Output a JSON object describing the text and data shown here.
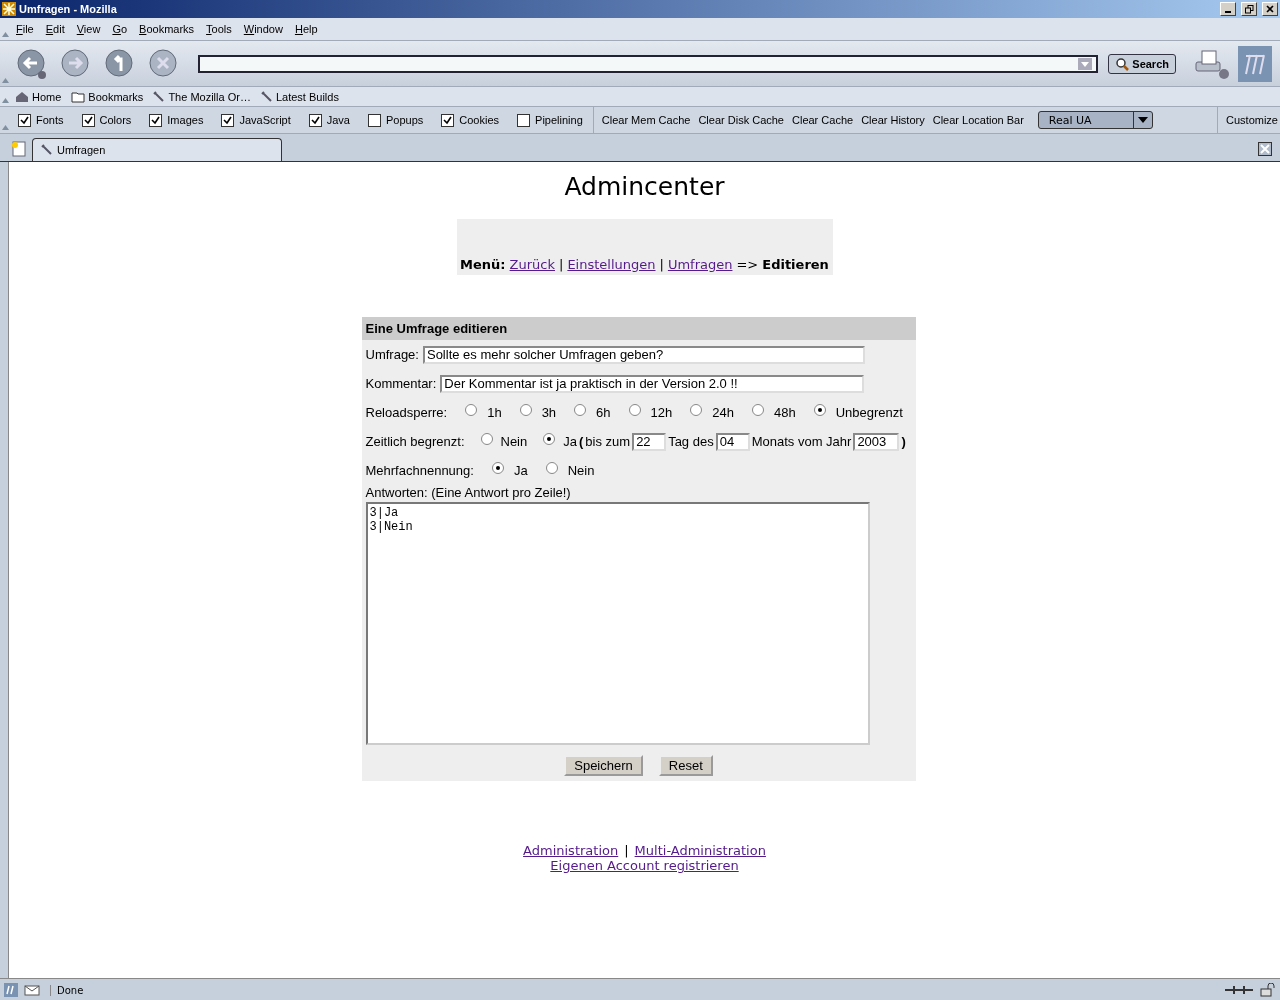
{
  "window": {
    "title": "Umfragen - Mozilla"
  },
  "menu": [
    "File",
    "Edit",
    "View",
    "Go",
    "Bookmarks",
    "Tools",
    "Window",
    "Help"
  ],
  "nav": {
    "search_button": "Search"
  },
  "personal_toolbar": [
    "Home",
    "Bookmarks",
    "The Mozilla Or…",
    "Latest Builds"
  ],
  "prefbar": {
    "checkboxes": [
      {
        "label": "Fonts",
        "checked": true
      },
      {
        "label": "Colors",
        "checked": true
      },
      {
        "label": "Images",
        "checked": true
      },
      {
        "label": "JavaScript",
        "checked": true
      },
      {
        "label": "Java",
        "checked": true
      },
      {
        "label": "Popups",
        "checked": false
      },
      {
        "label": "Cookies",
        "checked": true
      },
      {
        "label": "Pipelining",
        "checked": false
      }
    ],
    "buttons": [
      "Clear Mem Cache",
      "Clear Disk Cache",
      "Clear Cache",
      "Clear History",
      "Clear Location Bar"
    ],
    "ua_dropdown": "Real UA",
    "customize": "Customize"
  },
  "tabs": [
    {
      "label": "Umfragen",
      "selected": true
    }
  ],
  "page": {
    "heading": "Admincenter",
    "breadcrumb": {
      "label": "Menü:",
      "links": [
        "Zurück",
        "Einstellungen",
        "Umfragen"
      ],
      "separator": "|",
      "arrow": "=>",
      "current": "Editieren"
    },
    "form": {
      "title": "Eine Umfrage editieren",
      "umfrage": {
        "label": "Umfrage:",
        "value": "Sollte es mehr solcher Umfragen geben?"
      },
      "kommentar": {
        "label": "Kommentar:",
        "value": "Der Kommentar ist ja praktisch in der Version 2.0 !!"
      },
      "reloadsperre": {
        "label": "Reloadsperre:",
        "options": [
          {
            "label": "1h",
            "selected": false
          },
          {
            "label": "3h",
            "selected": false
          },
          {
            "label": "6h",
            "selected": false
          },
          {
            "label": "12h",
            "selected": false
          },
          {
            "label": "24h",
            "selected": false
          },
          {
            "label": "48h",
            "selected": false
          },
          {
            "label": "Unbegrenzt",
            "selected": true
          }
        ]
      },
      "zeitlich": {
        "label": "Zeitlich begrenzt:",
        "options": [
          {
            "label": "Nein",
            "selected": false
          },
          {
            "label": "Ja",
            "selected": true
          }
        ],
        "open_paren": "(",
        "bis_zum": "bis zum",
        "day": "22",
        "tag_des": "Tag des",
        "month": "04",
        "monats_vom_jahr": "Monats vom Jahr",
        "year": "2003",
        "close_paren": ")"
      },
      "mehrfach": {
        "label": "Mehrfachnennung:",
        "options": [
          {
            "label": "Ja",
            "selected": true
          },
          {
            "label": "Nein",
            "selected": false
          }
        ]
      },
      "antworten": {
        "label": "Antworten: (Eine Antwort pro Zeile!)",
        "lines": [
          "3|Ja",
          "3|Nein"
        ]
      },
      "buttons": [
        "Speichern",
        "Reset"
      ]
    },
    "footer": {
      "links": [
        "Administration",
        "Multi-Administration"
      ],
      "separator": "|",
      "register": "Eigenen Account registrieren"
    }
  },
  "status_bar": {
    "text": "Done"
  }
}
